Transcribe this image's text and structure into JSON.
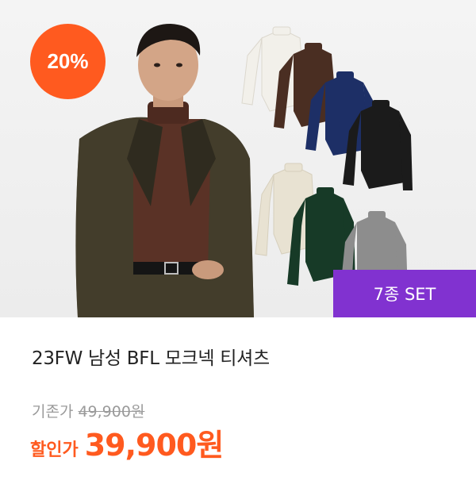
{
  "product": {
    "discount_badge": "20%",
    "set_badge": "7종 SET",
    "title": "23FW 남성 BFL 모크넥 티셔츠",
    "original_label": "기존가",
    "original_price": "49,900원",
    "sale_label": "할인가",
    "sale_price": "39,900원"
  },
  "colors": {
    "accent": "#ff5a1f",
    "set_badge_bg": "#8132d0",
    "shirt_colors": [
      "#f2f0ea",
      "#4a2e22",
      "#1d2f66",
      "#1b1b1b",
      "#e8e2d2",
      "#173a27",
      "#8d8d8d"
    ]
  }
}
